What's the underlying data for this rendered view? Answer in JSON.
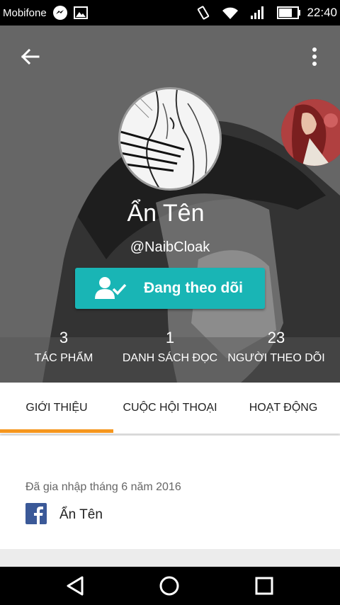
{
  "status_bar": {
    "carrier": "Mobifone",
    "time": "22:40",
    "icons": [
      "messenger-icon",
      "image-icon",
      "vibrate-icon",
      "wifi-icon",
      "signal-icon",
      "battery-icon"
    ]
  },
  "header": {
    "back_icon": "arrow-left-icon",
    "menu_icon": "more-vert-icon",
    "display_name": "Ẩn Tên",
    "username": "@NaibCloak",
    "follow_button": {
      "label": "Đang theo dõi",
      "icon": "user-check-icon"
    }
  },
  "stats": [
    {
      "value": "3",
      "label": "TÁC PHẨM"
    },
    {
      "value": "1",
      "label": "DANH SÁCH ĐỌC"
    },
    {
      "value": "23",
      "label": "NGƯỜI THEO DÕI"
    }
  ],
  "tabs": [
    {
      "label": "GIỚI THIỆU",
      "active": true
    },
    {
      "label": "CUỘC HỘI THOẠI",
      "active": false
    },
    {
      "label": "HOẠT ĐỘNG",
      "active": false
    }
  ],
  "about": {
    "joined": "Đã gia nhập tháng 6 năm 2016",
    "facebook_name": "Ẩn Tên"
  },
  "colors": {
    "accent": "#19b5b5",
    "tab_indicator": "#f5961e",
    "facebook": "#3b5998"
  },
  "nav_bar": [
    "back-triangle-icon",
    "home-circle-icon",
    "recents-square-icon"
  ]
}
